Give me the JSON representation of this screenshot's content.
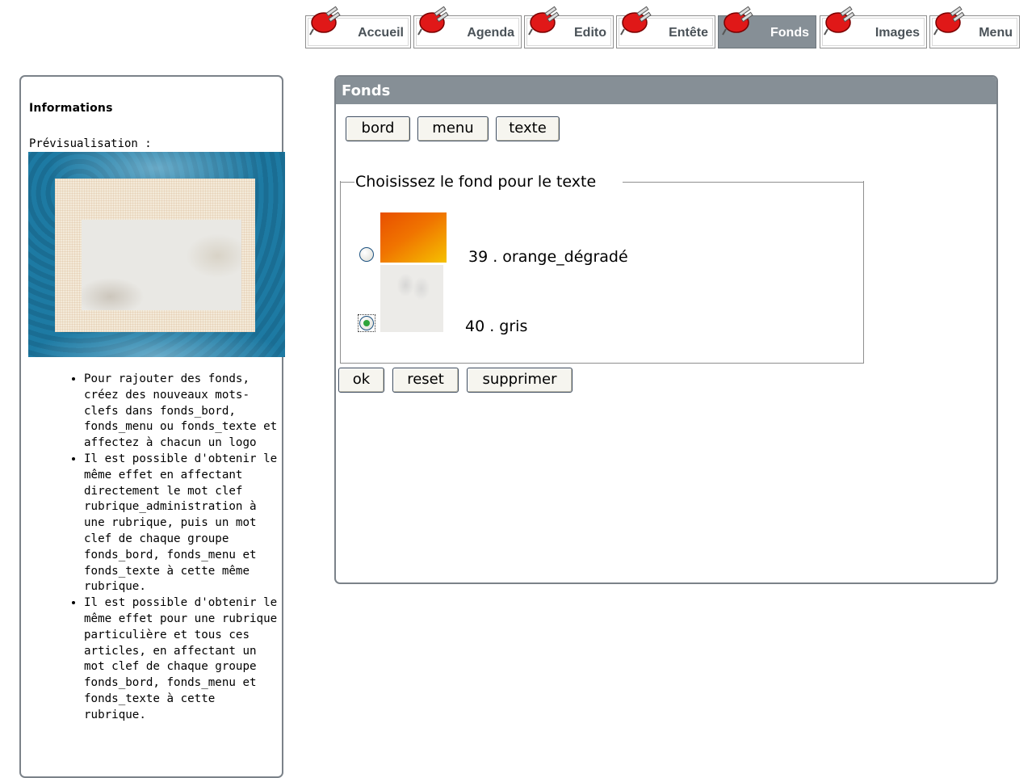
{
  "tabs": [
    {
      "label": "Accueil",
      "active": false
    },
    {
      "label": "Agenda",
      "active": false
    },
    {
      "label": "Edito",
      "active": false
    },
    {
      "label": "Entête",
      "active": false
    },
    {
      "label": "Fonds",
      "active": true
    },
    {
      "label": "Images",
      "active": false
    },
    {
      "label": "Menu",
      "active": false
    }
  ],
  "tab_icon": "red-plug-icon",
  "info": {
    "title": "Informations",
    "preview_label": "Prévisualisation :",
    "notes": [
      "Pour rajouter des fonds, créez des nouveaux mots-clefs dans fonds_bord, fonds_menu ou fonds_texte et affectez à chacun un logo",
      "Il est possible d'obtenir le même effet en affectant directement le mot clef rubrique_administration à une rubrique, puis un mot clef de chaque groupe fonds_bord, fonds_menu et fonds_texte à cette même rubrique.",
      "Il est possible d'obtenir le même effet pour une rubrique particulière et tous ces articles, en affectant un mot clef de chaque groupe fonds_bord, fonds_menu et fonds_texte à cette rubrique."
    ]
  },
  "panel": {
    "title": "Fonds",
    "category_buttons": [
      "bord",
      "menu",
      "texte"
    ],
    "fieldset_legend": "Choisissez le fond pour le texte",
    "options": [
      {
        "label": "39 . orange_dégradé",
        "selected": false
      },
      {
        "label": "40 . gris",
        "selected": true
      }
    ],
    "action_buttons": [
      "ok",
      "reset",
      "supprimer"
    ]
  },
  "colors": {
    "header_bg": "#868f96",
    "border": "#7b8289",
    "radio_checked": "#2ea43a",
    "plug_red": "#e01818"
  }
}
